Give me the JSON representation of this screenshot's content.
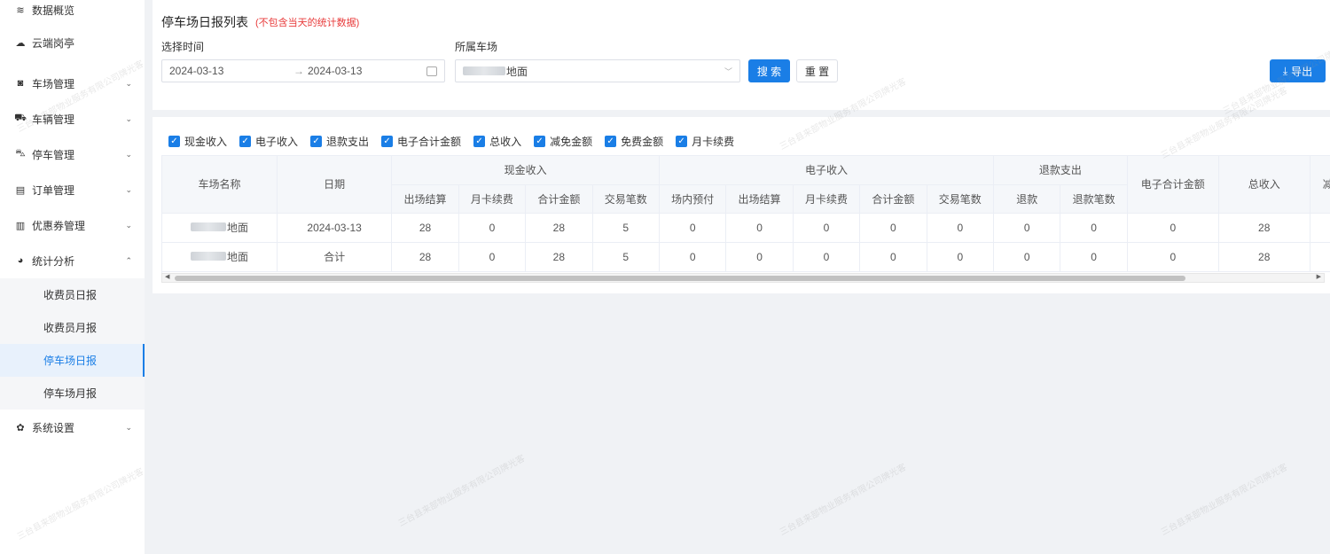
{
  "sidebar": {
    "items": [
      {
        "label": "数据概览",
        "icon": "layers-icon",
        "arrow": ""
      },
      {
        "label": "云端岗亭",
        "icon": "cloud-icon",
        "arrow": ""
      },
      {
        "label": "车场管理",
        "icon": "binoculars-icon",
        "arrow": "⌄"
      },
      {
        "label": "车辆管理",
        "icon": "car-icon",
        "arrow": "⌄"
      },
      {
        "label": "停车管理",
        "icon": "parking-car-icon",
        "arrow": "⌄"
      },
      {
        "label": "订单管理",
        "icon": "order-icon",
        "arrow": "⌄"
      },
      {
        "label": "优惠券管理",
        "icon": "coupon-icon",
        "arrow": "⌄"
      },
      {
        "label": "统计分析",
        "icon": "pie-chart-icon",
        "arrow": "⌃"
      }
    ],
    "subitems": [
      "收费员日报",
      "收费员月报",
      "停车场日报",
      "停车场月报"
    ],
    "settings": {
      "label": "系统设置",
      "icon": "gear-icon",
      "arrow": "⌄"
    }
  },
  "filter": {
    "title": "停车场日报列表",
    "subtitle": "(不包含当天的统计数据)",
    "date_label": "选择时间",
    "date_start": "2024-03-13",
    "date_sep": "→",
    "date_end": "2024-03-13",
    "lot_label": "所属车场",
    "lot_value": "地面",
    "search_label": "搜 索",
    "reset_label": "重 置",
    "export_label": "导出"
  },
  "columns_toggle": [
    "现金收入",
    "电子收入",
    "退款支出",
    "电子合计金额",
    "总收入",
    "减免金额",
    "免费金额",
    "月卡续费"
  ],
  "table": {
    "col_lot": "车场名称",
    "col_date": "日期",
    "group_cash": "现金收入",
    "group_elec": "电子收入",
    "group_refund": "退款支出",
    "col_elec_total": "电子合计金额",
    "col_total": "总收入",
    "col_cut": "减",
    "cash_cols": [
      "出场结算",
      "月卡续费",
      "合计金额",
      "交易笔数"
    ],
    "elec_cols": [
      "场内预付",
      "出场结算",
      "月卡续费",
      "合计金额",
      "交易笔数"
    ],
    "refund_cols": [
      "退款",
      "退款笔数"
    ],
    "rows": [
      {
        "lot": "地面",
        "date": "2024-03-13",
        "values": [
          "28",
          "0",
          "28",
          "5",
          "0",
          "0",
          "0",
          "0",
          "0",
          "0",
          "0",
          "0",
          "28"
        ]
      },
      {
        "lot": "地面",
        "date": "合计",
        "values": [
          "28",
          "0",
          "28",
          "5",
          "0",
          "0",
          "0",
          "0",
          "0",
          "0",
          "0",
          "0",
          "28"
        ]
      }
    ]
  },
  "watermark": "三台县来部物业服务有限公司牌光客"
}
